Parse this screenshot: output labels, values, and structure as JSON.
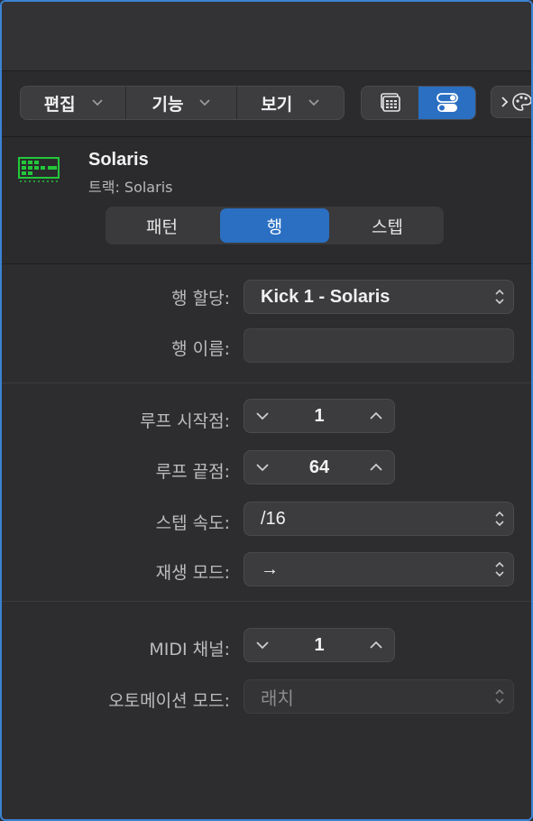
{
  "toolbar": {
    "menus": [
      {
        "label": "편집"
      },
      {
        "label": "기능"
      },
      {
        "label": "보기"
      }
    ]
  },
  "track": {
    "name": "Solaris",
    "subtitle": "트랙: Solaris"
  },
  "modes": [
    "패턴",
    "행",
    "스텝"
  ],
  "active_mode": "행",
  "fields": {
    "row_assign": {
      "label": "행 할당:",
      "value": "Kick 1 - Solaris"
    },
    "row_name": {
      "label": "행 이름:",
      "value": ""
    },
    "loop_start": {
      "label": "루프 시작점:",
      "value": "1"
    },
    "loop_end": {
      "label": "루프 끝점:",
      "value": "64"
    },
    "step_rate": {
      "label": "스텝 속도:",
      "value": "/16"
    },
    "playback_mode": {
      "label": "재생 모드:",
      "value": "→"
    },
    "midi_channel": {
      "label": "MIDI 채널:",
      "value": "1"
    },
    "automation_mode": {
      "label": "오토메이션 모드:",
      "value": "래치"
    }
  },
  "colors": {
    "accent": "#2a6fc2",
    "track_icon": "#22c83a",
    "window_border": "#3b82d4"
  }
}
